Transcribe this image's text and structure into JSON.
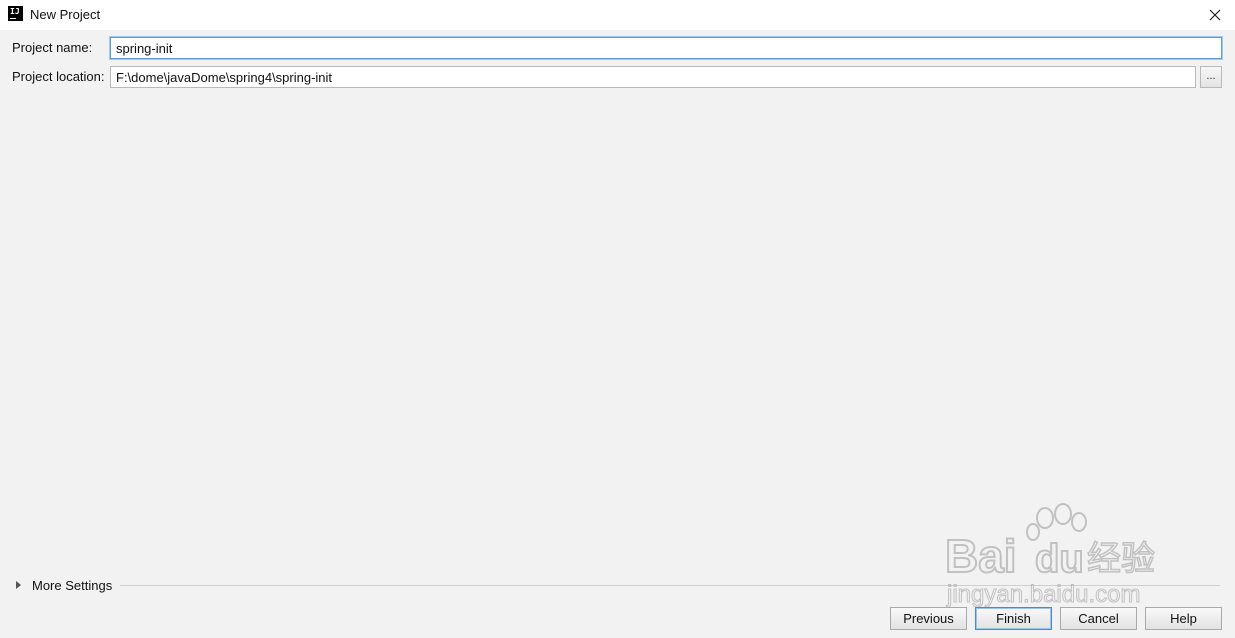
{
  "window": {
    "title": "New Project",
    "app_icon_text": "IJ"
  },
  "form": {
    "project_name_label": "Project name:",
    "project_name_value": "spring-init",
    "project_location_label": "Project location:",
    "project_location_value": "F:\\dome\\javaDome\\spring4\\spring-init",
    "browse_label": "..."
  },
  "more_settings": {
    "label": "More Settings"
  },
  "buttons": {
    "previous": "Previous",
    "finish": "Finish",
    "cancel": "Cancel",
    "help": "Help"
  },
  "watermark": {
    "brand_text": "Bai",
    "brand_text_2": "du",
    "cn_text": "经验",
    "url_text": "jingyan.baidu.com"
  },
  "colors": {
    "background": "#f2f2f2",
    "focus_border": "#5e9bd6",
    "default_button_border": "#4a8ad0"
  }
}
